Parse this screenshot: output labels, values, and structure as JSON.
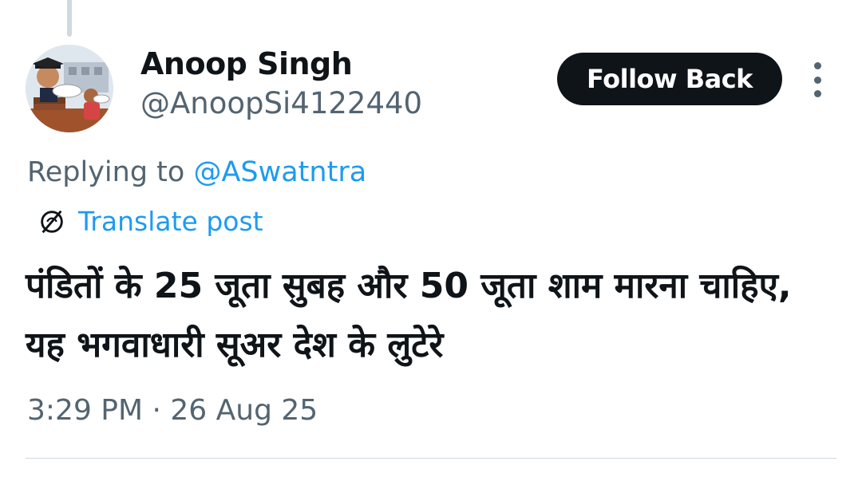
{
  "post": {
    "author": {
      "display_name": "Anoop Singh",
      "handle": "@AnoopSi4122440",
      "avatar_icon": "avatar-cartoon-icon"
    },
    "follow_button_label": "Follow Back",
    "more_icon": "more-vertical-icon",
    "replying": {
      "prefix": "Replying to ",
      "mention": "@ASwatntra"
    },
    "translate": {
      "icon": "globe-icon",
      "label": "Translate post"
    },
    "text": "पंडितों के 25 जूता सुबह और 50 जूता शाम मारना चाहिए, यह भगवाधारी सूअर देश के लुटेरे",
    "timestamp": "3:29 PM · 26 Aug 25"
  },
  "colors": {
    "accent": "#1d9bf0",
    "secondary_text": "#536471",
    "button_bg": "#0f1419",
    "divider": "#cfd9de"
  }
}
